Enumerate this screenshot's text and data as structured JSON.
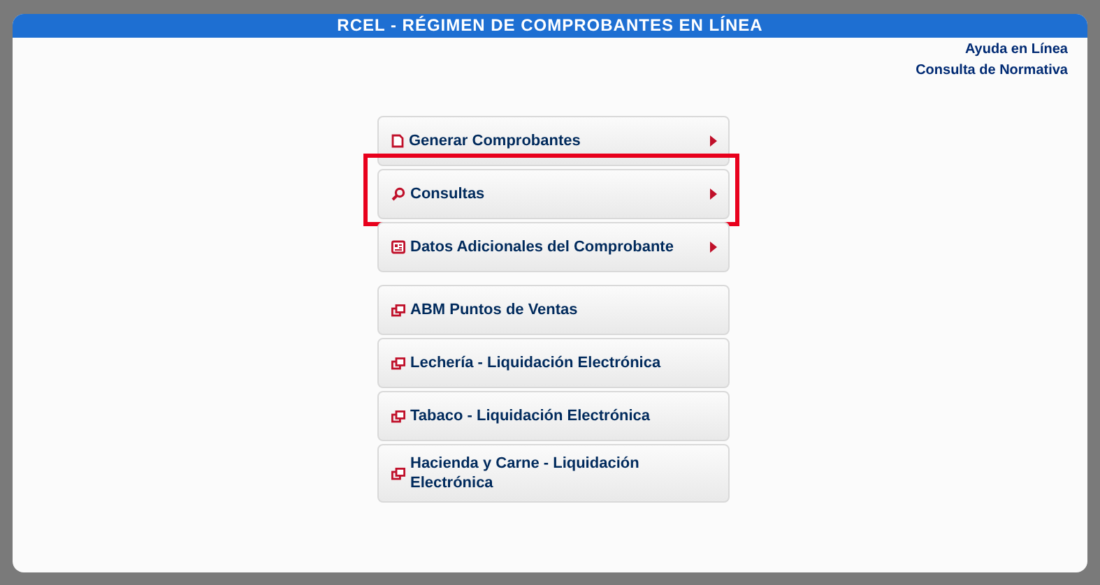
{
  "window": {
    "title": "RCEL - RÉGIMEN DE COMPROBANTES EN LÍNEA"
  },
  "links": [
    "Ayuda en Línea",
    "Consulta de Normativa"
  ],
  "menu_groups": [
    {
      "items": [
        {
          "label": "Generar Comprobantes",
          "kind": "document",
          "has_submenu": true,
          "highlighted": false
        },
        {
          "label": "Consultas",
          "kind": "search",
          "has_submenu": true,
          "highlighted": true
        },
        {
          "label": "Datos Adicionales del Comprobante",
          "kind": "card",
          "has_submenu": true,
          "highlighted": false
        }
      ]
    },
    {
      "items": [
        {
          "label": "ABM Puntos de Ventas",
          "kind": "window",
          "has_submenu": false,
          "highlighted": false
        },
        {
          "label": "Lechería - Liquidación Electrónica",
          "kind": "window",
          "has_submenu": false,
          "highlighted": false
        },
        {
          "label": "Tabaco - Liquidación Electrónica",
          "kind": "window",
          "has_submenu": false,
          "highlighted": false
        },
        {
          "label": "Hacienda y Carne - Liquidación Electrónica",
          "kind": "window",
          "has_submenu": false,
          "highlighted": false
        }
      ]
    }
  ]
}
